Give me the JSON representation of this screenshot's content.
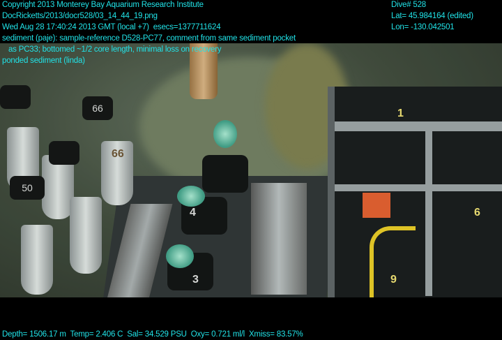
{
  "header": {
    "copyright": "Copyright 2013 Monterey Bay Aquarium Research Institute",
    "file_path": "DocRicketts/2013/docr528/03_14_44_19.png",
    "timestamp": "Wed Aug 28 17:40:24 2013 GMT (local +7)  esecs=1377711624",
    "annotation_line1": "sediment (paje): sample-reference D528-PC77, comment from same sediment pocket",
    "annotation_line2": "   as PC33; bottomed ~1/2 core length, minimal loss on recovery",
    "annotation_line3": "ponded sediment (linda)"
  },
  "nav": {
    "dive": "Dive# 528",
    "lat": "Lat= 45.984164 (edited)",
    "lon": "Lon= -130.042501"
  },
  "footer": {
    "telemetry": "Depth= 1506.17 m  Temp= 2.406 C  Sal= 34.529 PSU  Oxy= 0.721 ml/l  Xmiss= 83.57%"
  },
  "scene": {
    "core_labels": [
      "66",
      "50",
      "66"
    ],
    "rack_labels": [
      "1",
      "6",
      "9"
    ],
    "pusher_labels": [
      "4",
      "3"
    ]
  },
  "colors": {
    "overlay_text": "#21e3e8"
  }
}
